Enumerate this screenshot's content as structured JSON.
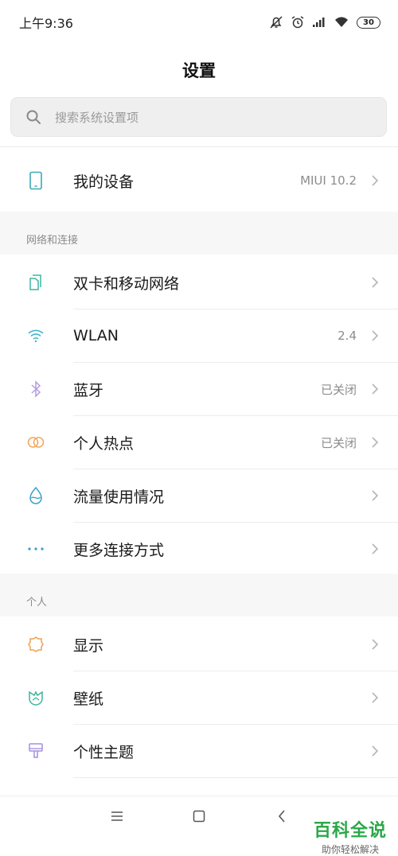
{
  "status": {
    "time": "上午9:36",
    "battery": "30"
  },
  "header": {
    "title": "设置"
  },
  "search": {
    "placeholder": "搜索系统设置项"
  },
  "device": {
    "label": "我的设备",
    "value": "MIUI 10.2"
  },
  "network": {
    "header": "网络和连接",
    "items": [
      {
        "label": "双卡和移动网络",
        "value": ""
      },
      {
        "label": "WLAN",
        "value": "2.4"
      },
      {
        "label": "蓝牙",
        "value": "已关闭"
      },
      {
        "label": "个人热点",
        "value": "已关闭"
      },
      {
        "label": "流量使用情况",
        "value": ""
      },
      {
        "label": "更多连接方式",
        "value": ""
      }
    ]
  },
  "personal": {
    "header": "个人",
    "items": [
      {
        "label": "显示"
      },
      {
        "label": "壁纸"
      },
      {
        "label": "个性主题"
      }
    ]
  },
  "watermark": {
    "main": "百科全说",
    "sub": "助你轻松解决"
  },
  "colors": {
    "device": "#3aa9b8",
    "sim": "#3bb6a0",
    "wlan": "#39b3c8",
    "bluetooth": "#b59ae0",
    "hotspot": "#f0a55a",
    "data": "#3aa2c8",
    "more": "#3a9ac8",
    "display": "#f0a050",
    "wallpaper": "#3cb59a",
    "theme": "#a58fe0"
  }
}
